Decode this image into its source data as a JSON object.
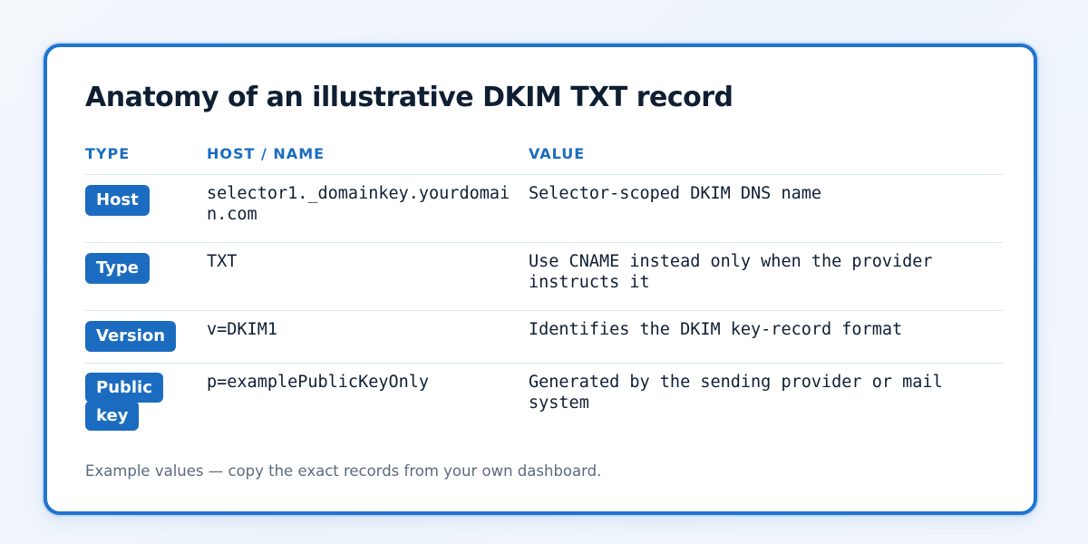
{
  "card": {
    "title": "Anatomy of an illustrative DKIM TXT record",
    "footnote": "Example values — copy the exact records from your own dashboard."
  },
  "table": {
    "headers": [
      "TYPE",
      "HOST / NAME",
      "VALUE"
    ],
    "rows": [
      {
        "badge": "Host",
        "host": "selector1._domainkey.yourdomain.com",
        "value": "Selector-scoped DKIM DNS name"
      },
      {
        "badge": "Type",
        "host": "TXT",
        "value": "Use CNAME instead only when the provider instructs it"
      },
      {
        "badge": "Version",
        "host": "v=DKIM1",
        "value": "Identifies the DKIM key-record format"
      },
      {
        "badge": "Public key",
        "host": "p=examplePublicKeyOnly",
        "value": "Generated by the sending provider or mail system"
      }
    ]
  },
  "colors": {
    "accent": "#1b6cc0",
    "border": "#1f74d0",
    "text": "#0f1f33",
    "muted": "#5a6b7e",
    "divider": "#d8e6f3"
  }
}
